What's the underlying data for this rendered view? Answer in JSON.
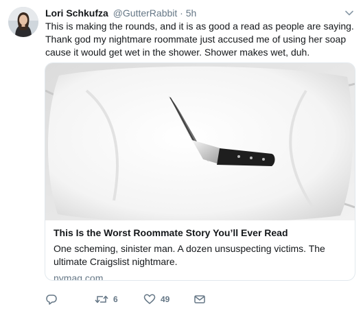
{
  "tweet": {
    "author_name": "Lori Schkufza",
    "handle": "@GutterRabbit",
    "separator": "·",
    "time": "5h",
    "text": "This is making the rounds, and it is as good a read as people are saying. Thank god my nightmare roommate just accused me of using her soap cause it would get wet in the shower. Shower makes wet, duh."
  },
  "card": {
    "title": "This Is the Worst Roommate Story You’ll Ever Read",
    "description": "One scheming, sinister man. A dozen unsuspecting victims. The ultimate Craigslist nightmare.",
    "domain": "nymag.com"
  },
  "actions": {
    "reply_icon": "reply-icon",
    "retweet_icon": "retweet-icon",
    "like_icon": "heart-icon",
    "dm_icon": "envelope-icon",
    "retweet_count": "6",
    "like_count": "49"
  },
  "colors": {
    "text": "#14171a",
    "secondary": "#657786",
    "border": "#e1e8ed"
  }
}
